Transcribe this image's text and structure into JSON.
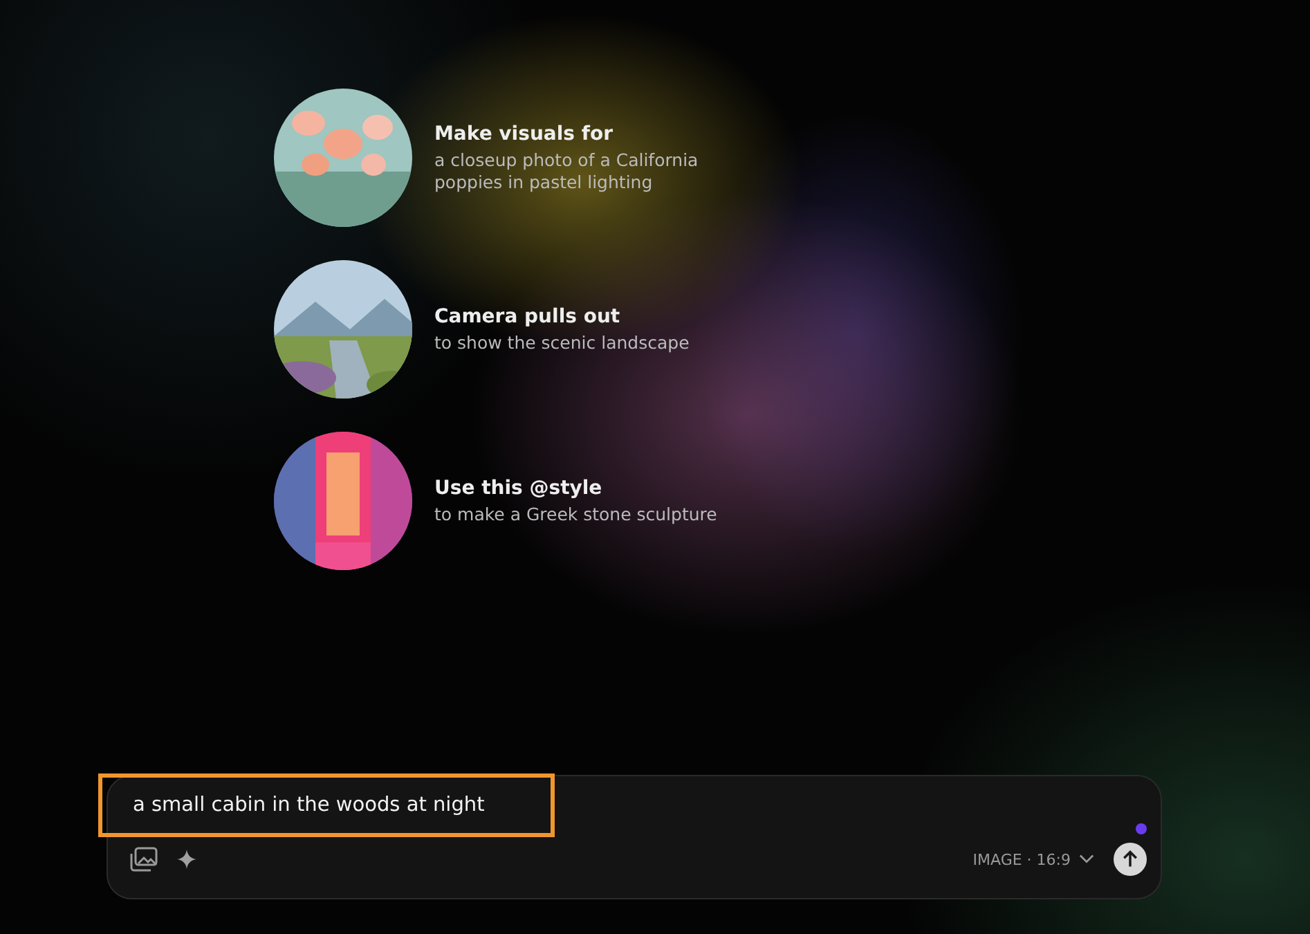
{
  "suggestions": [
    {
      "title": "Make visuals for",
      "subtitle": "a closeup photo of a California poppies in pastel lighting",
      "kind": "picture"
    },
    {
      "title": "Camera pulls out",
      "subtitle": "to show the scenic landscape",
      "kind": "picture"
    },
    {
      "title": "Use this @style",
      "subtitle": "to make a Greek stone sculpture",
      "kind": "picture"
    }
  ],
  "prompt": {
    "value": "a small cabin in the woods at night",
    "highlighted": true,
    "mode": "IMAGE · 16:9"
  }
}
